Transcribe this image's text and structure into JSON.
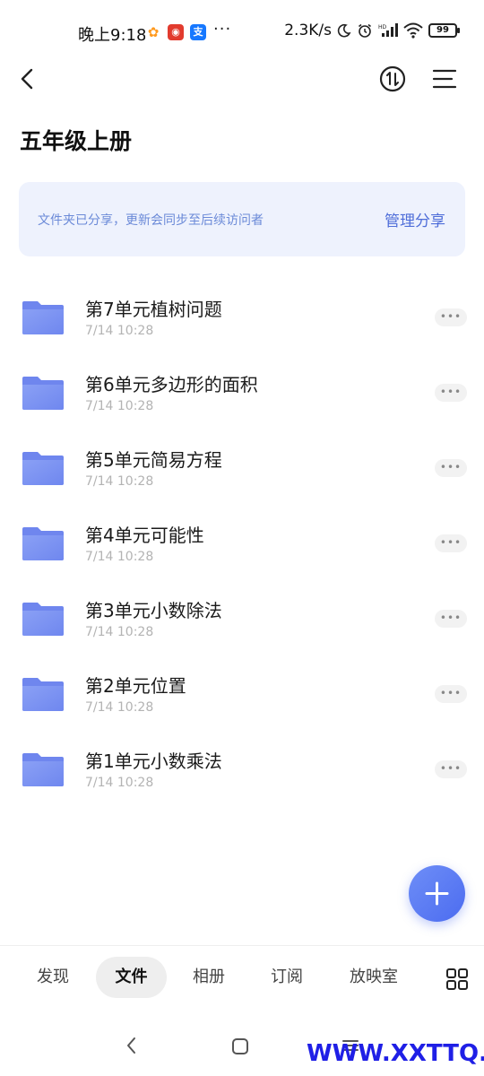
{
  "status_bar": {
    "time": "晚上9:18",
    "more": "···",
    "speed": "2.3K/s",
    "battery": "99",
    "app_icons": [
      {
        "name": "app-notification-icon",
        "glyph": "✿",
        "color": "#ff9a1f"
      },
      {
        "name": "netease-music-icon",
        "glyph": "◉",
        "color": "#e23b2e"
      },
      {
        "name": "alipay-icon",
        "glyph": "支",
        "color": "#1678ff"
      }
    ]
  },
  "header": {
    "title": "五年级上册"
  },
  "share_banner": {
    "text": "文件夹已分享，更新会同步至后续访问者",
    "action": "管理分享"
  },
  "folders": [
    {
      "name": "第7单元植树问题",
      "time": "7/14 10:28"
    },
    {
      "name": "第6单元多边形的面积",
      "time": "7/14 10:28"
    },
    {
      "name": "第5单元简易方程",
      "time": "7/14 10:28"
    },
    {
      "name": "第4单元可能性",
      "time": "7/14 10:28"
    },
    {
      "name": "第3单元小数除法",
      "time": "7/14 10:28"
    },
    {
      "name": "第2单元位置",
      "time": "7/14 10:28"
    },
    {
      "name": "第1单元小数乘法",
      "time": "7/14 10:28"
    }
  ],
  "more_label": "•••",
  "tabs": [
    {
      "label": "发现",
      "active": false
    },
    {
      "label": "文件",
      "active": true
    },
    {
      "label": "相册",
      "active": false
    },
    {
      "label": "订阅",
      "active": false
    },
    {
      "label": "放映室",
      "active": false
    }
  ],
  "watermark": "WWW.XXTTQ.COM",
  "colors": {
    "accent": "#4f6ed9",
    "banner_bg": "#eef2fd",
    "folder": "#7b93f2",
    "fab": "#5b7cf3"
  }
}
